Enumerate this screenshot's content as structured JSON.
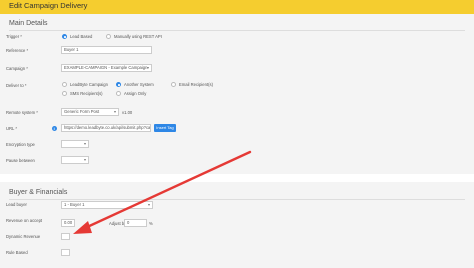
{
  "header": {
    "title": "Edit Campaign Delivery"
  },
  "main": {
    "title": "Main Details",
    "trigger": {
      "label": "Trigger *",
      "options": [
        "Lead Based",
        "Manually using REST API"
      ]
    },
    "reference": {
      "label": "Reference *",
      "value": "Buyer 1"
    },
    "campaign": {
      "label": "Campaign *",
      "value": "EXAMPLE-CAMPAIGN - Example Campaign"
    },
    "deliver_to": {
      "label": "Deliver to *",
      "options": [
        "LeadByte Campaign",
        "Another System",
        "Email Recipient(s)",
        "SMS Recipient(s)",
        "Assign Only"
      ]
    },
    "remote_system": {
      "label": "Remote system *",
      "value": "Generic Form Post",
      "version": "v1.00"
    },
    "url": {
      "label": "URL *",
      "value": "https://demo.leadbyte.co.uk/api/submit.php?campid=",
      "button": "Insert Tag"
    },
    "encryption": {
      "label": "Encryption type"
    },
    "pause": {
      "label": "Pause between"
    }
  },
  "buyer": {
    "title": "Buyer & Financials",
    "lead_buyer": {
      "label": "Lead buyer",
      "value": "1 - Buyer 1"
    },
    "revenue": {
      "label": "Revenue on accept",
      "value": "0.00",
      "adjust_label": "Adjust by",
      "adjust_value": "0",
      "unit": "%"
    },
    "dynamic": {
      "label": "Dynamic Revenue"
    },
    "rule_based": {
      "label": "Rule Based"
    }
  },
  "colors": {
    "header": "#f5cd2f",
    "accent": "#2e87e6",
    "arrow": "#e53935"
  }
}
